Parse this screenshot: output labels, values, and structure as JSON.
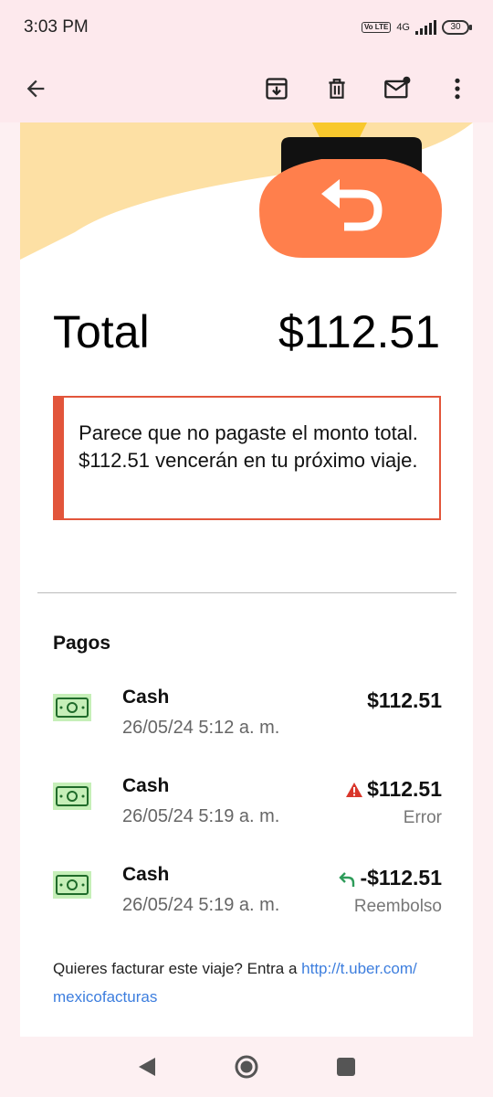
{
  "status_bar": {
    "time": "3:03 PM",
    "volte": "Vo LTE",
    "network": "4G",
    "battery": "30"
  },
  "app_bar": {
    "icons": [
      "back-arrow-icon",
      "archive-icon",
      "trash-icon",
      "mark-unread-icon",
      "more-vert-icon"
    ]
  },
  "email": {
    "total_label": "Total",
    "total_amount": "$112.51",
    "alert_text": "Parece que no pagaste el monto total. $112.51 vencerán en tu próximo viaje.",
    "payments_title": "Pagos",
    "payments": [
      {
        "method": "Cash",
        "date": "26/05/24 5:12 a. m.",
        "amount": "$112.51",
        "status": "",
        "icon": "none"
      },
      {
        "method": "Cash",
        "date": "26/05/24 5:19 a. m.",
        "amount": "$112.51",
        "status": "Error",
        "icon": "warning"
      },
      {
        "method": "Cash",
        "date": "26/05/24 5:19 a. m.",
        "amount": "-$112.51",
        "status": "Reembolso",
        "icon": "refund"
      }
    ],
    "footer_text": "Quieres facturar este viaje? Entra a ",
    "footer_link": "http://t.uber.com/ mexicofacturas"
  },
  "colors": {
    "accent_red": "#e2553b",
    "wallet_orange": "#ff7f4c",
    "link_blue": "#3d7ede",
    "refund_green": "#2e9c5a"
  }
}
